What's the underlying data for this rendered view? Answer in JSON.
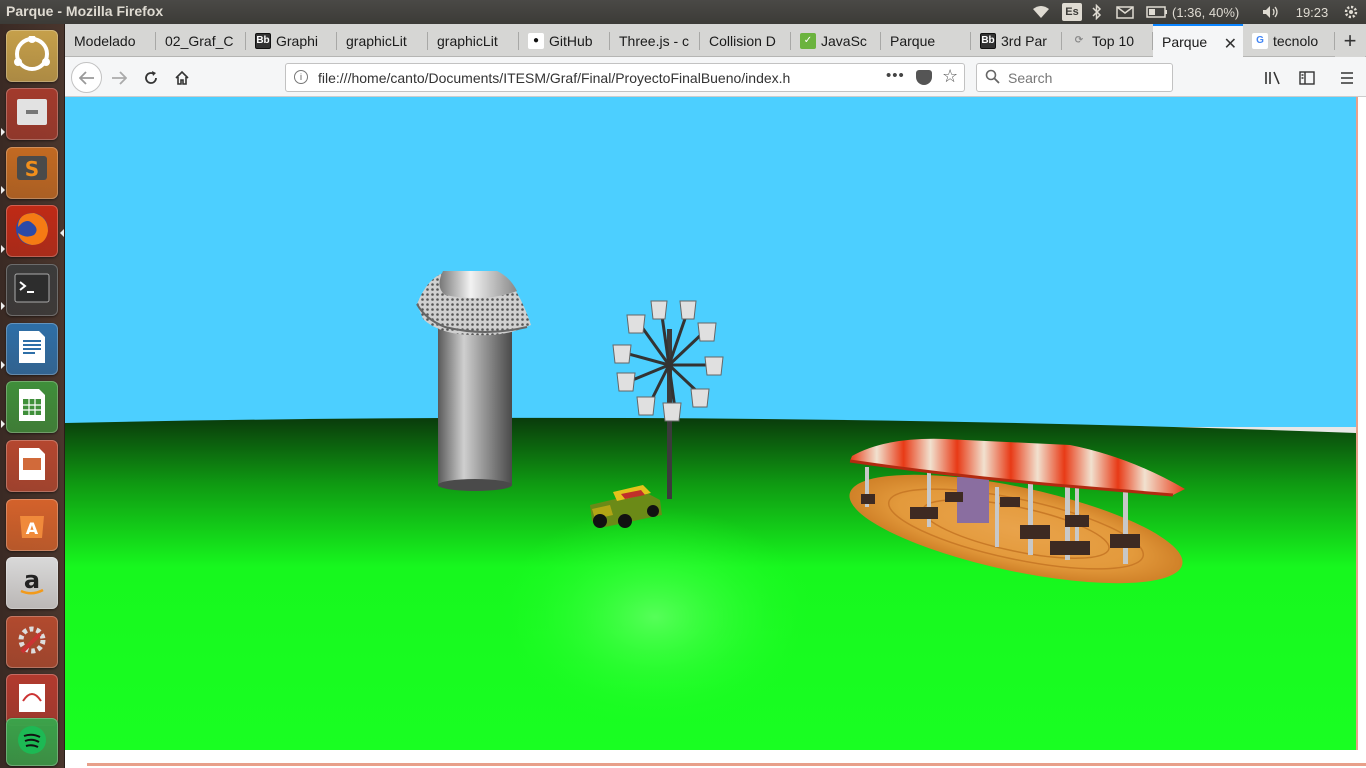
{
  "window": {
    "title": "Parque - Mozilla Firefox"
  },
  "tray": {
    "keyboard_layout": "Es",
    "battery": "(1:36, 40%)",
    "clock": "19:23",
    "icons": [
      "wifi-icon",
      "bluetooth-icon",
      "mail-icon",
      "battery-icon",
      "volume-icon",
      "gear-icon"
    ]
  },
  "launcher": {
    "items": [
      {
        "name": "ubuntu-home-icon",
        "color": "#c6a04a"
      },
      {
        "name": "files-icon",
        "color": "#a33a2c"
      },
      {
        "name": "sublime-text-icon",
        "color": "#c36a22"
      },
      {
        "name": "firefox-icon",
        "color": "#c02a16"
      },
      {
        "name": "terminal-icon",
        "color": "#3b3b3b"
      },
      {
        "name": "libreoffice-writer-icon",
        "color": "#2e6fa8"
      },
      {
        "name": "libreoffice-calc-icon",
        "color": "#3f8f3a"
      },
      {
        "name": "libreoffice-impress-icon",
        "color": "#b5472f"
      },
      {
        "name": "software-center-icon",
        "color": "#d4622b"
      },
      {
        "name": "amazon-icon",
        "color": "#d9d9d9"
      },
      {
        "name": "system-settings-icon",
        "color": "#b24a2e"
      },
      {
        "name": "evince-icon",
        "color": "#b23a2e"
      },
      {
        "name": "spotify-icon",
        "color": "#3aa34a"
      }
    ]
  },
  "tabs": [
    {
      "label": "Modelado",
      "icon": ""
    },
    {
      "label": "02_Graf_C",
      "icon": ""
    },
    {
      "label": "Graphi",
      "icon": "Bb"
    },
    {
      "label": "graphicLit",
      "icon": ""
    },
    {
      "label": "graphicLit",
      "icon": ""
    },
    {
      "label": "GitHub",
      "icon": "github"
    },
    {
      "label": "Three.js - c",
      "icon": ""
    },
    {
      "label": "Collision D",
      "icon": ""
    },
    {
      "label": "JavaSc",
      "icon": "js"
    },
    {
      "label": "Parque",
      "icon": ""
    },
    {
      "label": "3rd Par",
      "icon": "Bb"
    },
    {
      "label": "Top 10",
      "icon": "top"
    },
    {
      "label": "Parque",
      "icon": "",
      "active": true
    },
    {
      "label": "tecnolo",
      "icon": "G"
    }
  ],
  "nav": {
    "url": "file:///home/canto/Documents/ITESM/Graf/Final/ProyectoFinalBueno/index.h",
    "url_more": "•••",
    "search_placeholder": "Search"
  },
  "scene": {
    "description_objects": [
      "tower",
      "ferris-wheel",
      "toy-car",
      "carousel"
    ],
    "sky_color": "#4ccfff",
    "ground_color": "#17f81e"
  }
}
